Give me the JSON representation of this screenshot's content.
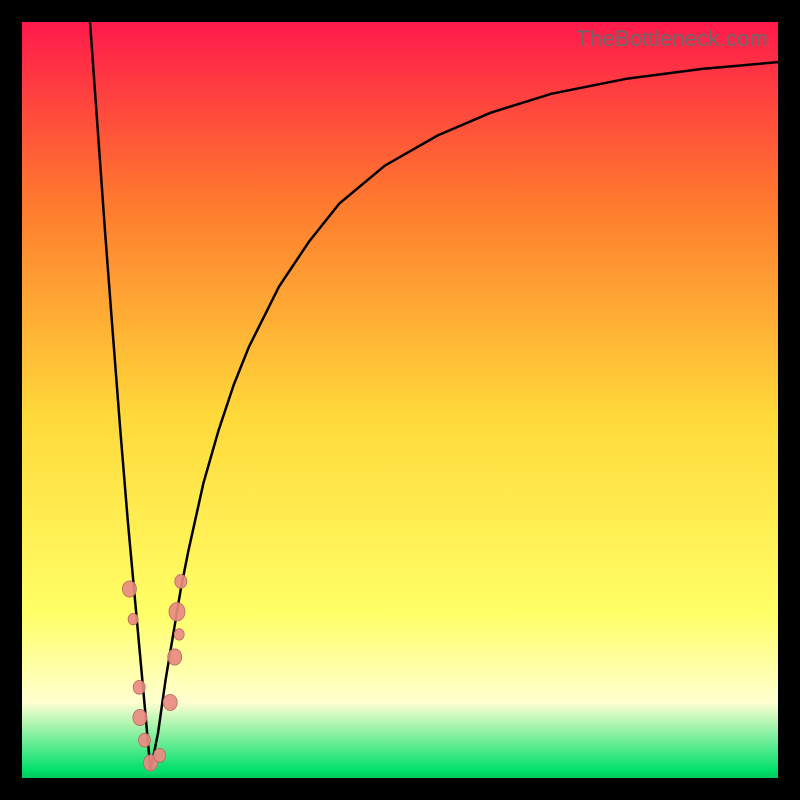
{
  "watermark": "TheBottleneck.com",
  "colors": {
    "frame": "#000000",
    "gradient_top": "#ff1a4b",
    "gradient_mid_upper": "#ff7a2e",
    "gradient_mid": "#ffd93a",
    "gradient_lower": "#ffff66",
    "gradient_pale": "#ffffd0",
    "gradient_bottom": "#00e06a",
    "curve": "#000000",
    "marker_fill": "#e98b82",
    "marker_stroke": "#b86a62"
  },
  "chart_data": {
    "type": "line",
    "title": "",
    "xlabel": "",
    "ylabel": "",
    "x_range": [
      0,
      100
    ],
    "y_range": [
      0,
      100
    ],
    "optimum_x": 17,
    "series": [
      {
        "name": "bottleneck-curve",
        "x": [
          9,
          10,
          11,
          12,
          13,
          14,
          15,
          16,
          17,
          18,
          19,
          20,
          21,
          22,
          24,
          26,
          28,
          30,
          34,
          38,
          42,
          48,
          55,
          62,
          70,
          80,
          90,
          100
        ],
        "y": [
          100,
          86,
          72,
          59,
          46,
          34,
          23,
          12,
          1,
          6,
          13,
          19,
          25,
          30,
          39,
          46,
          52,
          57,
          65,
          71,
          76,
          81,
          85,
          88,
          90.5,
          92.5,
          93.8,
          94.7
        ]
      }
    ],
    "markers": [
      {
        "x": 14.2,
        "y": 25,
        "r": 7
      },
      {
        "x": 14.7,
        "y": 21,
        "r": 5
      },
      {
        "x": 15.5,
        "y": 12,
        "r": 6
      },
      {
        "x": 15.6,
        "y": 8,
        "r": 7
      },
      {
        "x": 16.2,
        "y": 5,
        "r": 6
      },
      {
        "x": 17.0,
        "y": 2,
        "r": 7
      },
      {
        "x": 18.2,
        "y": 3,
        "r": 6
      },
      {
        "x": 19.6,
        "y": 10,
        "r": 7
      },
      {
        "x": 20.2,
        "y": 16,
        "r": 7
      },
      {
        "x": 20.5,
        "y": 22,
        "r": 8
      },
      {
        "x": 21.0,
        "y": 26,
        "r": 6
      },
      {
        "x": 20.8,
        "y": 19,
        "r": 5
      }
    ]
  }
}
